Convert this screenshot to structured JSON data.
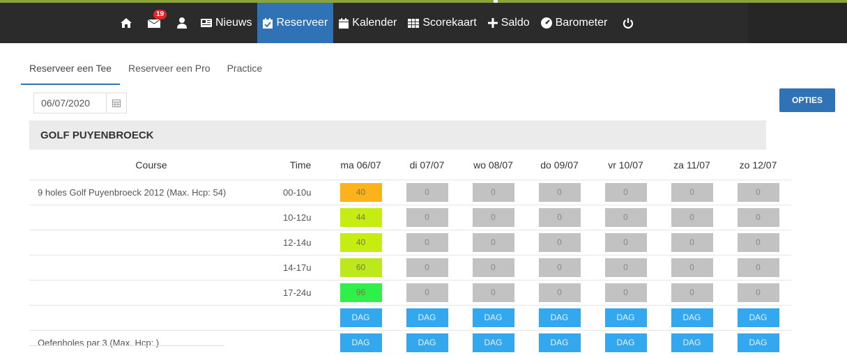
{
  "nav": {
    "badge_count": "19",
    "items": [
      {
        "label": "Nieuws",
        "icon": "news-icon"
      },
      {
        "label": "Reserveer",
        "icon": "calendar-check-icon"
      },
      {
        "label": "Kalender",
        "icon": "calendar-icon"
      },
      {
        "label": "Scorekaart",
        "icon": "grid-icon"
      },
      {
        "label": "Saldo",
        "icon": "plus-icon"
      },
      {
        "label": "Barometer",
        "icon": "gauge-icon"
      }
    ]
  },
  "tabs": [
    {
      "label": "Reserveer een Tee"
    },
    {
      "label": "Reserveer een Pro"
    },
    {
      "label": "Practice"
    }
  ],
  "date": {
    "value": "06/07/2020"
  },
  "opties_label": "OPTIES",
  "club_name": "GOLF PUYENBROECK",
  "table": {
    "headers": {
      "course": "Course",
      "time": "Time",
      "days": [
        "ma 06/07",
        "di 07/07",
        "wo 08/07",
        "do 09/07",
        "vr 10/07",
        "za 11/07",
        "zo 12/07"
      ]
    },
    "course1": "9 holes Golf Puyenbroeck 2012 (Max. Hcp: 54)",
    "course2": "Oefenholes par 3 (Max. Hcp: )",
    "rows": [
      {
        "time": "00-10u",
        "first": "40",
        "first_color": "#fbb21b",
        "rest": "0"
      },
      {
        "time": "10-12u",
        "first": "44",
        "first_color": "#c6ed12",
        "rest": "0"
      },
      {
        "time": "12-14u",
        "first": "40",
        "first_color": "#c6ed12",
        "rest": "0"
      },
      {
        "time": "14-17u",
        "first": "60",
        "first_color": "#bde91c",
        "rest": "0"
      },
      {
        "time": "17-24u",
        "first": "96",
        "first_color": "#2ff04a",
        "rest": "0"
      }
    ],
    "dag_label": "DAG"
  }
}
